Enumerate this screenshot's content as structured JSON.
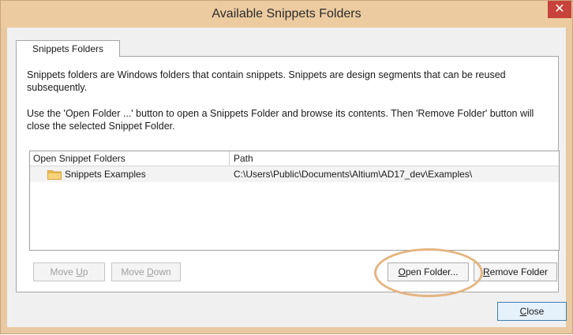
{
  "window": {
    "title": "Available Snippets Folders",
    "close_glyph": "✕"
  },
  "tabs": [
    {
      "label": "Snippets Folders"
    }
  ],
  "description": {
    "line1": "Snippets folders are Windows folders that contain snippets. Snippets are design segments that can be reused subsequently.",
    "line2": "Use the 'Open Folder ...' button to open a Snippets Folder and browse its contents. Then 'Remove Folder' button will close the selected Snippet Folder."
  },
  "table": {
    "columns": [
      "Open Snippet Folders",
      "Path"
    ],
    "rows": [
      {
        "icon": "folder-icon",
        "name": "Snippets Examples",
        "path": "C:\\Users\\Public\\Documents\\Altium\\AD17_dev\\Examples\\"
      }
    ]
  },
  "buttons": {
    "move_up": {
      "pre": "Move ",
      "key": "U",
      "post": "p"
    },
    "move_down": {
      "pre": "Move ",
      "key": "D",
      "post": "own"
    },
    "open_folder": {
      "pre": "",
      "key": "O",
      "post": "pen Folder..."
    },
    "remove_folder": {
      "pre": "",
      "key": "R",
      "post": "emove Folder"
    },
    "close": {
      "pre": "",
      "key": "C",
      "post": "lose"
    }
  },
  "colors": {
    "frame": "#edcba0",
    "close_button": "#c7423a",
    "highlight": "#e4b480",
    "folder": "#f2c35c"
  }
}
